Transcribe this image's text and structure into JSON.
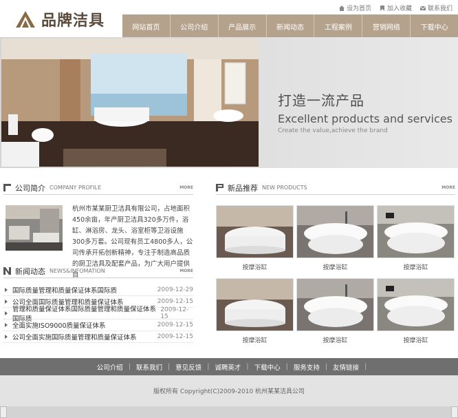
{
  "header": {
    "logo_text": "品牌洁具",
    "top_links": [
      {
        "label": "设为首页",
        "icon": "home-icon"
      },
      {
        "label": "加入收藏",
        "icon": "bookmark-icon"
      },
      {
        "label": "联系我们",
        "icon": "mail-icon"
      }
    ],
    "nav": [
      "网站首页",
      "公司介绍",
      "产品展示",
      "新闻动态",
      "工程案例",
      "营销网络",
      "下载中心"
    ]
  },
  "banner": {
    "title_cn": "打造一流产品",
    "title_en": "Excellent products and services",
    "subtitle": "Create the value,achieve the brand"
  },
  "profile": {
    "title_cn": "公司简介",
    "title_en": "COMPANY PROFILE",
    "more": "MORE",
    "text": "杭州市某某厨卫洁具有限公司，占地面积450余亩，年产厨卫洁具320多万件，浴缸、淋浴房、龙头、浴室柜等卫浴设施300多万套。公司现有员工4800多人，公司传承开拓创新精神，专注于制造高品质的厨卫洁具及配套产品，为广大用户提供自"
  },
  "news": {
    "title_cn": "新闻动态",
    "title_en": "NEWS&INFOMATION",
    "more": "MORE",
    "items": [
      {
        "title": "国际质量管理和质量保证体系国际质",
        "date": "2009-12-29"
      },
      {
        "title": "公司全面国际质量管理和质量保证体系",
        "date": "2009-12-15"
      },
      {
        "title": "管理和质量保证体系国际质量管理和质量保证体系国际质",
        "date": "2009-12-15"
      },
      {
        "title": "全面实施ISO9000质量保证体系",
        "date": "2009-12-15"
      },
      {
        "title": "公司全面实施国际质量管理和质量保证体系",
        "date": "2009-12-15"
      }
    ]
  },
  "products": {
    "title_cn": "新品推荐",
    "title_en": "NEW PRODUCTS",
    "more": "MORE",
    "items": [
      "按摩浴缸",
      "按摩浴缸",
      "按摩浴缸",
      "按摩浴缸",
      "按摩浴缸",
      "按摩浴缸"
    ]
  },
  "footer": {
    "links": [
      "公司介绍",
      "联系我们",
      "意见反馈",
      "诚聘英才",
      "下载中心",
      "服务支持",
      "友情链接"
    ],
    "copyright": "版权所有  Copyright(C)2009-2010 杭州某某洁具公司"
  },
  "colors": {
    "nav_bg": "#b5a28d",
    "footer_nav_bg": "#6f6f6f",
    "copyright_bg": "#e3e3e3",
    "banner_bg": "#dcdcdc"
  }
}
